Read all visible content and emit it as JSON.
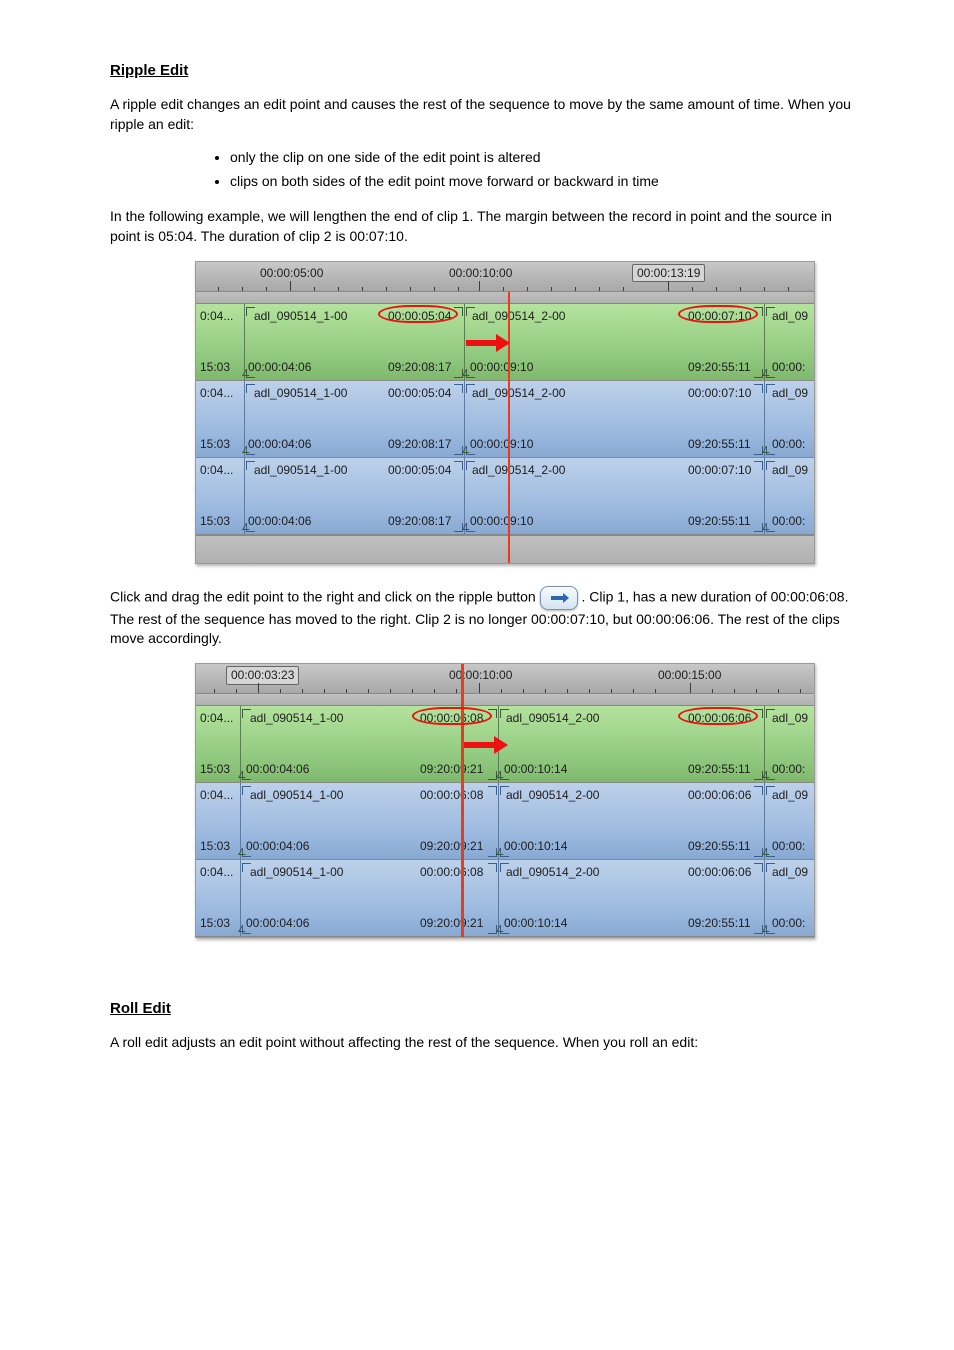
{
  "section_ripple": {
    "heading": "Ripple Edit",
    "p1": "A ripple edit changes an edit point and causes the rest of the sequence to move by the same amount of time. When you ripple an edit:",
    "bullets": [
      "only the clip on one side of the edit point is altered",
      "clips on both sides of the edit point move forward or backward in time"
    ],
    "p2": "In the following example, we will lengthen the end of clip 1. The margin between the record in point and the source in point is 05:04. The duration of clip 2 is 00:07:10.",
    "p3_a": "Click and drag the edit point to the right and click on the ripple button ",
    "p3_b": ". Clip 1, has a new duration of 00:00:06:08. The rest of the sequence has moved to the right. Clip 2 is no longer 00:00:07:10, but 00:00:06:06. The rest of the clips move accordingly."
  },
  "timeline_a": {
    "ruler": {
      "t1": "00:00:05:00",
      "t2": "00:00:10:00",
      "t3_boxed": "00:00:13:19"
    },
    "row": {
      "c0_top": "0:04...",
      "c1_name": "adl_090514_1-00",
      "c1_dur": "00:00:05:04",
      "c2_name": "adl_090514_2-00",
      "c2_dur": "00:00:07:10",
      "c3_name": "adl_09",
      "bl0": "15:03",
      "bl1": "00:00:04:06",
      "br1": "09:20:08:17",
      "bl2": "00:00:09:10",
      "br2": "09:20:55:11",
      "bl3": "00:00:"
    }
  },
  "timeline_b": {
    "ruler": {
      "t1_boxed": "00:00:03:23",
      "t2": "00:00:10:00",
      "t3": "00:00:15:00"
    },
    "row": {
      "c0_top": "0:04...",
      "c1_name": "adl_090514_1-00",
      "c1_dur": "00:00:06:08",
      "c2_name": "adl_090514_2-00",
      "c2_dur": "00:00:06:06",
      "c3_name": "adl_09",
      "bl0": "15:03",
      "bl1": "00:00:04:06",
      "br1": "09:20:09:21",
      "bl2": "00:00:10:14",
      "br2": "09:20:55:11",
      "bl3": "00:00:"
    }
  },
  "section_roll": {
    "heading": "Roll Edit",
    "p1": "A roll edit adjusts an edit point without affecting the rest of the sequence. When you roll an edit:"
  }
}
